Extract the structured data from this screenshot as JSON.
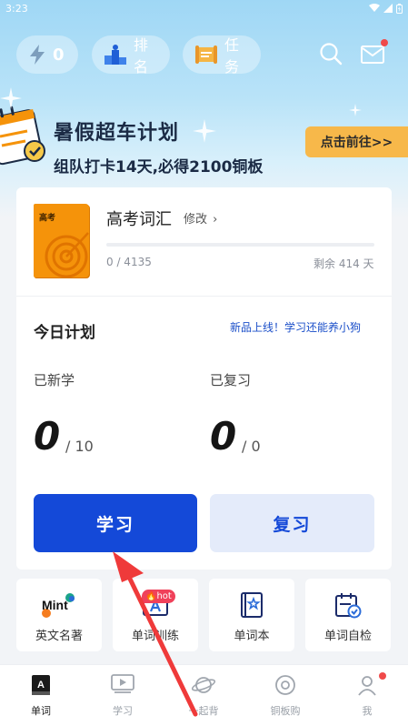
{
  "status_bar": {
    "time": "3:23"
  },
  "header": {
    "energy_count": "0",
    "rank_label": "排名",
    "task_label": "任务"
  },
  "banner": {
    "title": "暑假超车计划",
    "subtitle": "组队打卡14天,必得2100铜板",
    "cta": "点击前往>>"
  },
  "book": {
    "cover_label": "高考",
    "title": "高考词汇",
    "edit_label": "修改",
    "progress_text": "0 / 4135",
    "progress_fraction": 0,
    "remaining_text": "剩余 414 天"
  },
  "plan": {
    "title": "今日计划",
    "promo_link": "新品上线！学习还能养小狗",
    "learned_label": "已新学",
    "learned_value": "0",
    "learned_goal": "/ 10",
    "reviewed_label": "已复习",
    "reviewed_value": "0",
    "reviewed_goal": "/ 0"
  },
  "actions": {
    "study_label": "学习",
    "review_label": "复习"
  },
  "tools": [
    {
      "label": "英文名著",
      "icon": "mint-logo-icon",
      "logo_text": "Mint"
    },
    {
      "label": "单词训练",
      "icon": "word-training-icon",
      "badge": "hot"
    },
    {
      "label": "单词本",
      "icon": "wordbook-icon"
    },
    {
      "label": "单词自检",
      "icon": "calendar-check-icon"
    }
  ],
  "nav": [
    {
      "label": "单词",
      "icon": "word-book-icon"
    },
    {
      "label": "学习",
      "icon": "video-icon"
    },
    {
      "label": "一起背",
      "icon": "planet-icon"
    },
    {
      "label": "铜板购",
      "icon": "coin-icon"
    },
    {
      "label": "我",
      "icon": "person-icon"
    }
  ],
  "colors": {
    "primary": "#1449d8",
    "accent_orange": "#f5930a",
    "cta_yellow": "#f7b84a",
    "badge_red": "#f0415a"
  }
}
